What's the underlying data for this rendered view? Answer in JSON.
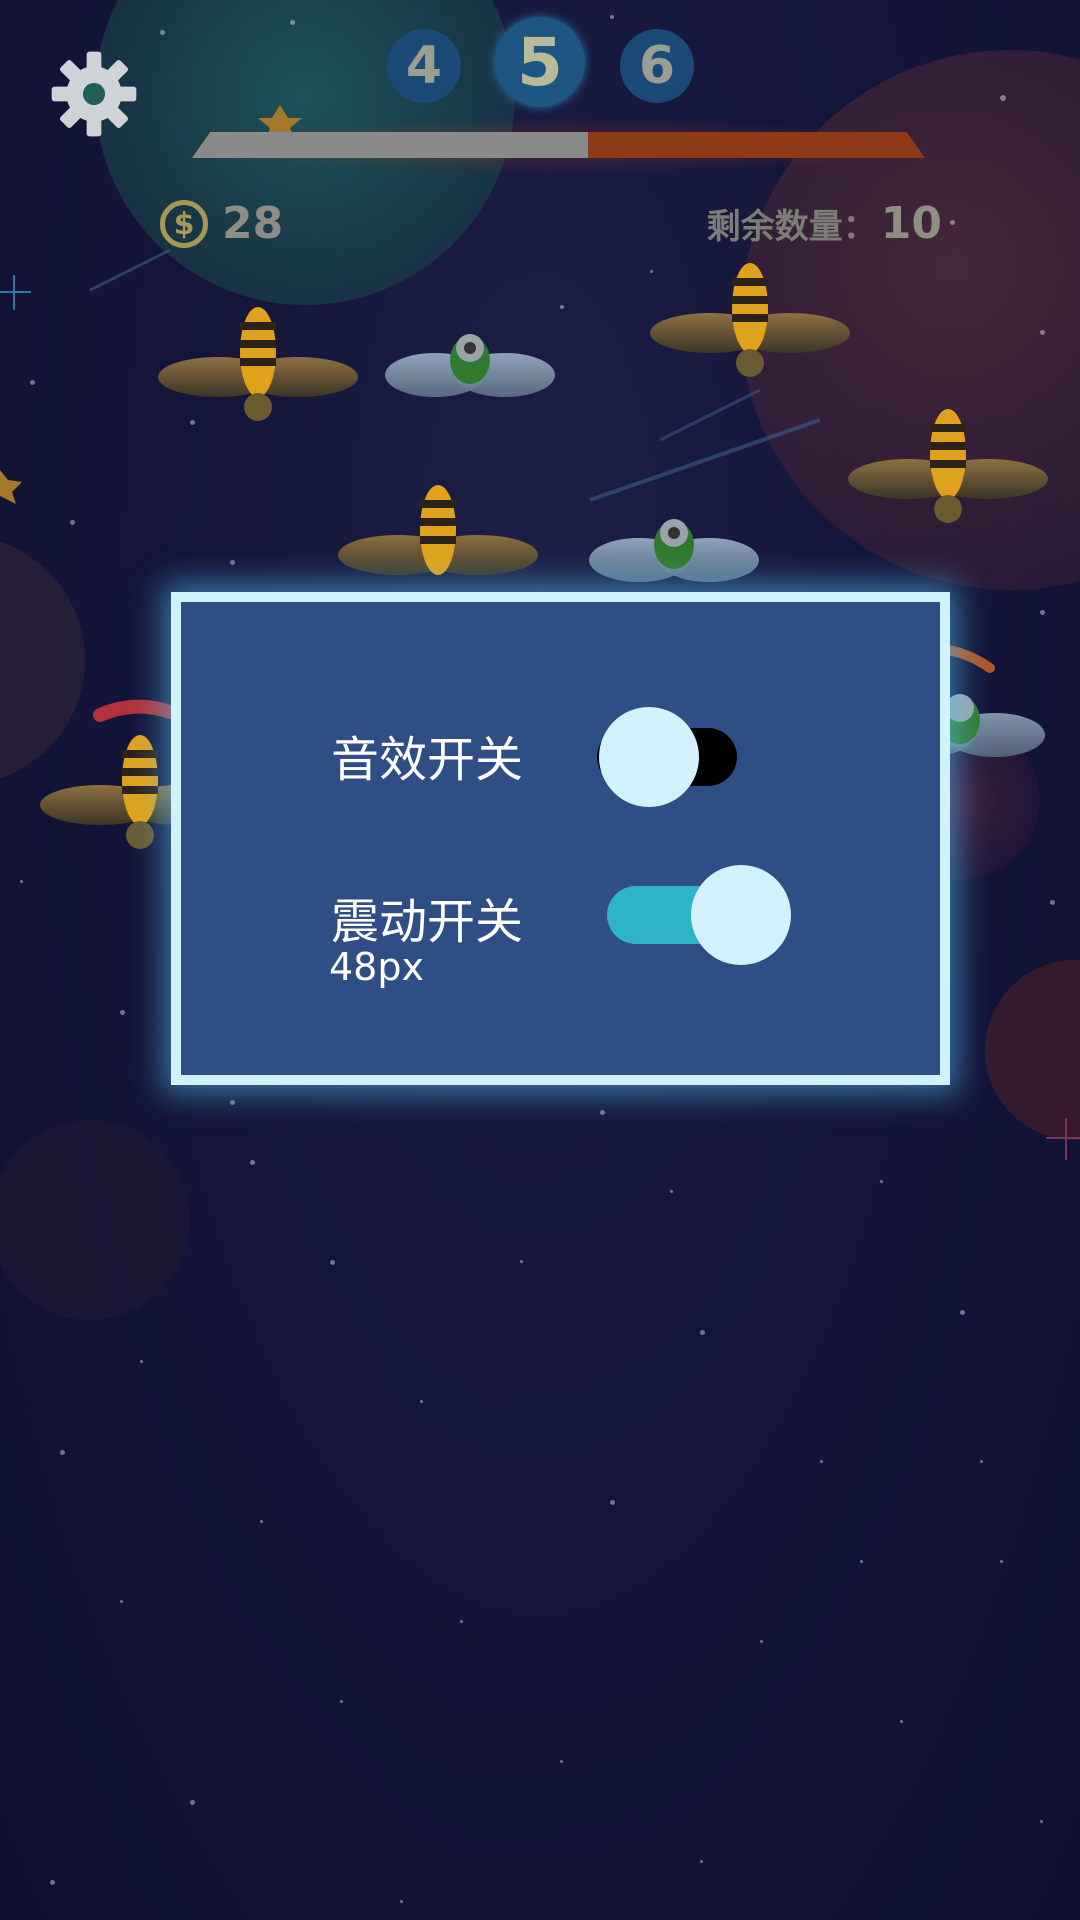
{
  "hud": {
    "levels": {
      "prev": "4",
      "current": "5",
      "next": "6"
    },
    "progress": 0.54,
    "coins": "28",
    "remaining_label": "剩余数量：",
    "remaining_value": "10"
  },
  "settings": {
    "sound_label": "音效开关",
    "sound_on": false,
    "vibration_label": "震动开关",
    "vibration_on": true,
    "vibration_note": "48px"
  },
  "colors": {
    "dialog_bg": "#2f4e86",
    "dialog_border": "#d2f2fb",
    "toggle_on": "#2db4c8",
    "toggle_off": "#000000",
    "knob": "#d3f1fd",
    "progress_filled": "#8a8a8a",
    "progress_empty": "#8c3a17"
  },
  "icons": {
    "settings": "gear-icon",
    "coin": "coin-icon"
  }
}
